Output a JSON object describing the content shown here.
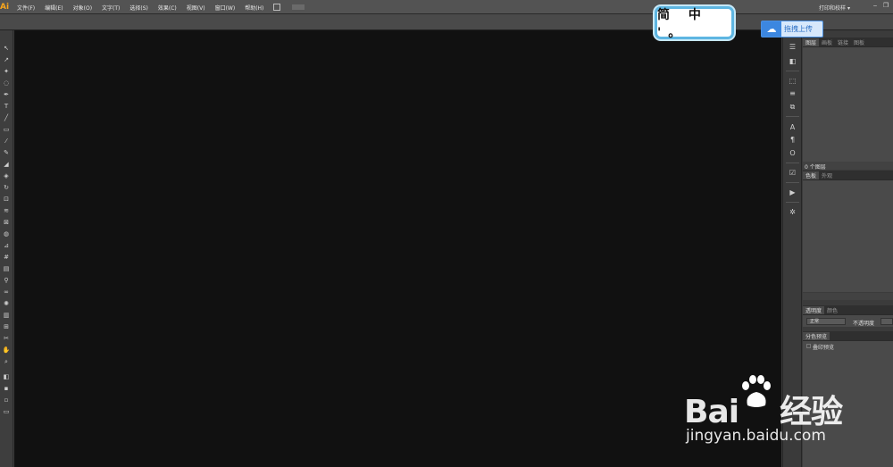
{
  "app": {
    "logo": "Ai",
    "workspace": "打印和校样",
    "workspace_arrow": "▾"
  },
  "menu": [
    "文件(F)",
    "编辑(E)",
    "对象(O)",
    "文字(T)",
    "选择(S)",
    "效果(C)",
    "视图(V)",
    "窗口(W)",
    "帮助(H)"
  ],
  "window_buttons": [
    "‒",
    "❐"
  ],
  "overlay_badge": "简 中 '。",
  "upload_button": {
    "icon": "cloud-icon",
    "label": "拖拽上传"
  },
  "panels": {
    "top_tabs": [
      "图层",
      "画板",
      "链接",
      "图板"
    ],
    "layers_footer": "0 个图层",
    "color_tabs": [
      "色板",
      "外观"
    ],
    "transparency_tabs": [
      "透明度",
      "颜色"
    ],
    "blend_mode": "正常",
    "opacity_label": "不透明度",
    "separation_title": "分色预览",
    "overprint_label": "叠印预览"
  },
  "watermark": {
    "brand_left": "Bai",
    "brand_right": "经验",
    "url": "jingyan.baidu.com"
  }
}
